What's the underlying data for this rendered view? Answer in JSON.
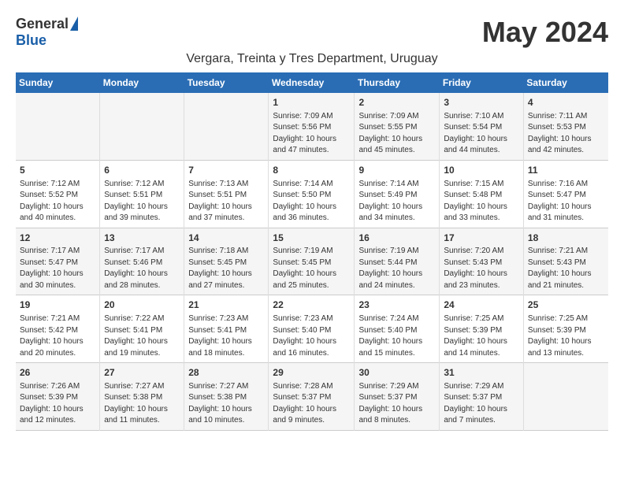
{
  "logo": {
    "general": "General",
    "blue": "Blue"
  },
  "title": "May 2024",
  "location": "Vergara, Treinta y Tres Department, Uruguay",
  "days_header": [
    "Sunday",
    "Monday",
    "Tuesday",
    "Wednesday",
    "Thursday",
    "Friday",
    "Saturday"
  ],
  "weeks": [
    [
      {
        "day": "",
        "content": ""
      },
      {
        "day": "",
        "content": ""
      },
      {
        "day": "",
        "content": ""
      },
      {
        "day": "1",
        "content": "Sunrise: 7:09 AM\nSunset: 5:56 PM\nDaylight: 10 hours and 47 minutes."
      },
      {
        "day": "2",
        "content": "Sunrise: 7:09 AM\nSunset: 5:55 PM\nDaylight: 10 hours and 45 minutes."
      },
      {
        "day": "3",
        "content": "Sunrise: 7:10 AM\nSunset: 5:54 PM\nDaylight: 10 hours and 44 minutes."
      },
      {
        "day": "4",
        "content": "Sunrise: 7:11 AM\nSunset: 5:53 PM\nDaylight: 10 hours and 42 minutes."
      }
    ],
    [
      {
        "day": "5",
        "content": "Sunrise: 7:12 AM\nSunset: 5:52 PM\nDaylight: 10 hours and 40 minutes."
      },
      {
        "day": "6",
        "content": "Sunrise: 7:12 AM\nSunset: 5:51 PM\nDaylight: 10 hours and 39 minutes."
      },
      {
        "day": "7",
        "content": "Sunrise: 7:13 AM\nSunset: 5:51 PM\nDaylight: 10 hours and 37 minutes."
      },
      {
        "day": "8",
        "content": "Sunrise: 7:14 AM\nSunset: 5:50 PM\nDaylight: 10 hours and 36 minutes."
      },
      {
        "day": "9",
        "content": "Sunrise: 7:14 AM\nSunset: 5:49 PM\nDaylight: 10 hours and 34 minutes."
      },
      {
        "day": "10",
        "content": "Sunrise: 7:15 AM\nSunset: 5:48 PM\nDaylight: 10 hours and 33 minutes."
      },
      {
        "day": "11",
        "content": "Sunrise: 7:16 AM\nSunset: 5:47 PM\nDaylight: 10 hours and 31 minutes."
      }
    ],
    [
      {
        "day": "12",
        "content": "Sunrise: 7:17 AM\nSunset: 5:47 PM\nDaylight: 10 hours and 30 minutes."
      },
      {
        "day": "13",
        "content": "Sunrise: 7:17 AM\nSunset: 5:46 PM\nDaylight: 10 hours and 28 minutes."
      },
      {
        "day": "14",
        "content": "Sunrise: 7:18 AM\nSunset: 5:45 PM\nDaylight: 10 hours and 27 minutes."
      },
      {
        "day": "15",
        "content": "Sunrise: 7:19 AM\nSunset: 5:45 PM\nDaylight: 10 hours and 25 minutes."
      },
      {
        "day": "16",
        "content": "Sunrise: 7:19 AM\nSunset: 5:44 PM\nDaylight: 10 hours and 24 minutes."
      },
      {
        "day": "17",
        "content": "Sunrise: 7:20 AM\nSunset: 5:43 PM\nDaylight: 10 hours and 23 minutes."
      },
      {
        "day": "18",
        "content": "Sunrise: 7:21 AM\nSunset: 5:43 PM\nDaylight: 10 hours and 21 minutes."
      }
    ],
    [
      {
        "day": "19",
        "content": "Sunrise: 7:21 AM\nSunset: 5:42 PM\nDaylight: 10 hours and 20 minutes."
      },
      {
        "day": "20",
        "content": "Sunrise: 7:22 AM\nSunset: 5:41 PM\nDaylight: 10 hours and 19 minutes."
      },
      {
        "day": "21",
        "content": "Sunrise: 7:23 AM\nSunset: 5:41 PM\nDaylight: 10 hours and 18 minutes."
      },
      {
        "day": "22",
        "content": "Sunrise: 7:23 AM\nSunset: 5:40 PM\nDaylight: 10 hours and 16 minutes."
      },
      {
        "day": "23",
        "content": "Sunrise: 7:24 AM\nSunset: 5:40 PM\nDaylight: 10 hours and 15 minutes."
      },
      {
        "day": "24",
        "content": "Sunrise: 7:25 AM\nSunset: 5:39 PM\nDaylight: 10 hours and 14 minutes."
      },
      {
        "day": "25",
        "content": "Sunrise: 7:25 AM\nSunset: 5:39 PM\nDaylight: 10 hours and 13 minutes."
      }
    ],
    [
      {
        "day": "26",
        "content": "Sunrise: 7:26 AM\nSunset: 5:39 PM\nDaylight: 10 hours and 12 minutes."
      },
      {
        "day": "27",
        "content": "Sunrise: 7:27 AM\nSunset: 5:38 PM\nDaylight: 10 hours and 11 minutes."
      },
      {
        "day": "28",
        "content": "Sunrise: 7:27 AM\nSunset: 5:38 PM\nDaylight: 10 hours and 10 minutes."
      },
      {
        "day": "29",
        "content": "Sunrise: 7:28 AM\nSunset: 5:37 PM\nDaylight: 10 hours and 9 minutes."
      },
      {
        "day": "30",
        "content": "Sunrise: 7:29 AM\nSunset: 5:37 PM\nDaylight: 10 hours and 8 minutes."
      },
      {
        "day": "31",
        "content": "Sunrise: 7:29 AM\nSunset: 5:37 PM\nDaylight: 10 hours and 7 minutes."
      },
      {
        "day": "",
        "content": ""
      }
    ]
  ]
}
